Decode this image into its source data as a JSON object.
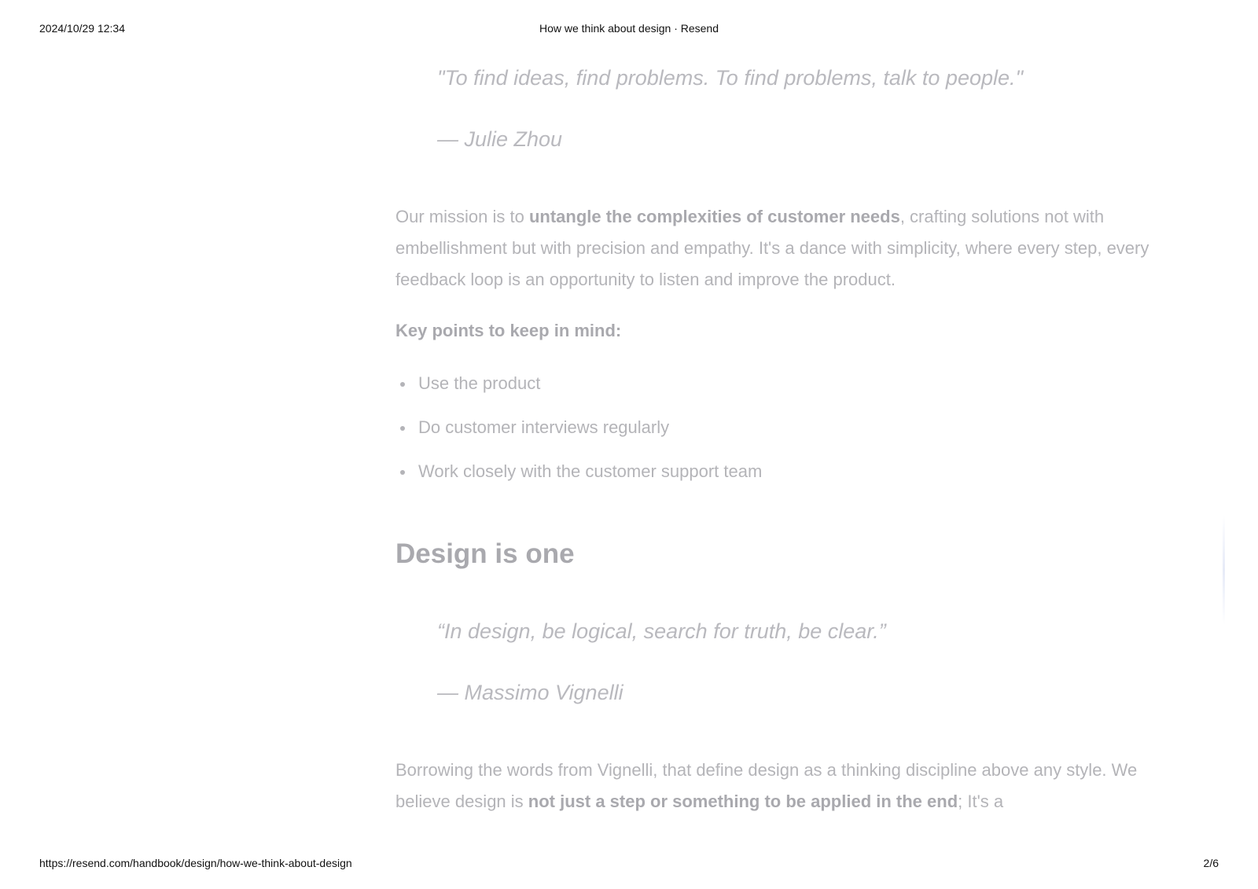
{
  "print_header": {
    "date": "2024/10/29 12:34",
    "title": "How we think about design · Resend"
  },
  "print_footer": {
    "url": "https://resend.com/handbook/design/how-we-think-about-design",
    "page": "2/6"
  },
  "article": {
    "quote1": {
      "text": "\"To find ideas, find problems. To find problems, talk to people.\"",
      "author": "— Julie Zhou"
    },
    "mission": {
      "pre": "Our mission is to ",
      "bold": "untangle the complexities of customer needs",
      "post": ", crafting solutions not with embellishment but with precision and empathy. It's a dance with simplicity, where every step, every feedback loop is an opportunity to listen and improve the product."
    },
    "key_points_label": "Key points to keep in mind:",
    "key_points": [
      "Use the product",
      "Do customer interviews regularly",
      "Work closely with the customer support team"
    ],
    "section_heading": "Design is one",
    "quote2": {
      "text": "“In design, be logical, search for truth, be clear.”",
      "author": "— Massimo Vignelli"
    },
    "closing": {
      "pre": "Borrowing the words from Vignelli, that define design as a thinking discipline above any style. We believe design is ",
      "bold": "not just a step or something to be applied in the end",
      "post": "; It's a"
    }
  }
}
